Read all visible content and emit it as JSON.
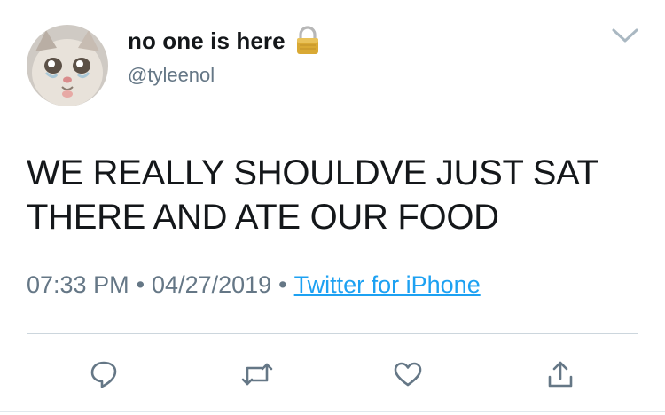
{
  "user": {
    "display_name": "no one is here",
    "handle": "@tyleenol",
    "avatar_icon": "crying-cat-avatar",
    "protected_icon": "lock-icon"
  },
  "tweet": {
    "text": "WE REALLY SHOULDVE JUST SAT THERE AND ATE OUR FOOD",
    "time": "07:33 PM",
    "date": "04/27/2019",
    "separator": "•",
    "source": "Twitter for iPhone"
  },
  "menu": {
    "icon": "chevron-down-icon"
  },
  "actions": [
    {
      "icon": "reply-icon"
    },
    {
      "icon": "retweet-icon"
    },
    {
      "icon": "like-icon"
    },
    {
      "icon": "share-icon"
    }
  ],
  "colors": {
    "text": "#14171a",
    "secondary": "#657786",
    "link": "#1da1f2",
    "divider": "#ccd6dd",
    "lock_gold": "#d9a934"
  }
}
